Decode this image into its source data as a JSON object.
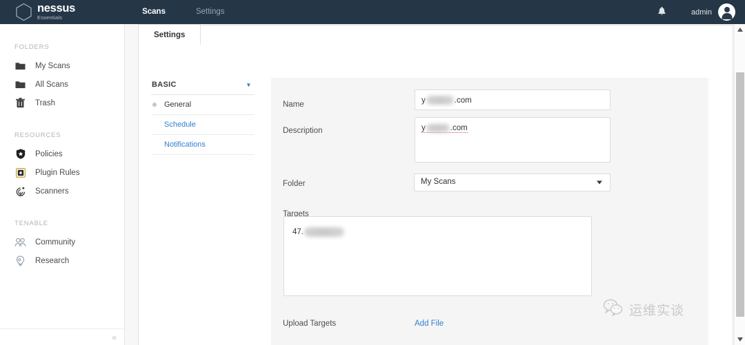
{
  "topbar": {
    "brand_name": "nessus",
    "brand_sub": "Essentials",
    "nav": [
      {
        "label": "Scans",
        "active": true
      },
      {
        "label": "Settings",
        "active": false
      }
    ],
    "bell_icon": "bell-icon",
    "user_name": "admin",
    "avatar_icon": "user-avatar-icon"
  },
  "sidebar": {
    "sections": [
      {
        "title": "FOLDERS",
        "items": [
          {
            "label": "My Scans",
            "icon": "folder-icon"
          },
          {
            "label": "All Scans",
            "icon": "folder-icon"
          },
          {
            "label": "Trash",
            "icon": "trash-icon"
          }
        ]
      },
      {
        "title": "RESOURCES",
        "items": [
          {
            "label": "Policies",
            "icon": "shield-icon"
          },
          {
            "label": "Plugin Rules",
            "icon": "plugin-icon"
          },
          {
            "label": "Scanners",
            "icon": "radar-icon"
          }
        ]
      },
      {
        "title": "TENABLE",
        "items": [
          {
            "label": "Community",
            "icon": "people-icon"
          },
          {
            "label": "Research",
            "icon": "research-icon"
          }
        ]
      }
    ],
    "collapse_label": "«"
  },
  "content": {
    "tabs": [
      {
        "label": "Settings",
        "active": true
      }
    ],
    "confignav": {
      "group_label": "BASIC",
      "chevron_icon": "chevron-down-icon",
      "items": [
        {
          "label": "General",
          "active": true
        },
        {
          "label": "Schedule",
          "active": false
        },
        {
          "label": "Notifications",
          "active": false
        }
      ]
    },
    "form": {
      "name": {
        "label": "Name",
        "value_prefix": "y",
        "value_suffix": ".com",
        "redacted": true
      },
      "description": {
        "label": "Description",
        "value_prefix": "y",
        "value_suffix": ".com",
        "redacted": true
      },
      "folder": {
        "label": "Folder",
        "value": "My Scans",
        "caret_icon": "chevron-down-icon"
      },
      "targets": {
        "label": "Targets",
        "value_prefix": "47.",
        "redacted": true
      },
      "upload_targets": {
        "label": "Upload Targets",
        "action_label": "Add File"
      }
    }
  },
  "watermark": {
    "icon": "wechat-icon",
    "text": "运维实谈"
  },
  "scrollbar": {
    "up_icon": "triangle-up-icon",
    "down_icon": "triangle-down-icon",
    "thumb": "scrollbar-thumb"
  },
  "colors": {
    "topbar_bg": "#253647",
    "link_blue": "#2f7fd0",
    "panel_bg": "#f5f5f5"
  }
}
